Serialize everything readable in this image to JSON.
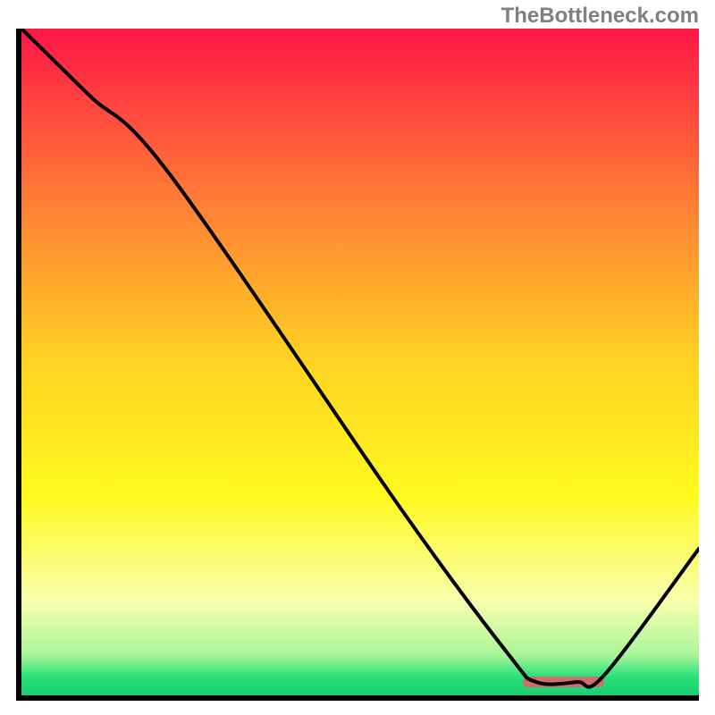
{
  "watermark": "TheBottleneck.com",
  "chart_data": {
    "type": "line",
    "title": "",
    "xlabel": "",
    "ylabel": "",
    "xlim": [
      0,
      100
    ],
    "ylim": [
      0,
      100
    ],
    "grid": false,
    "legend": false,
    "background": {
      "type": "vertical-gradient",
      "stops": [
        {
          "offset": 0.0,
          "color": "#ff1647"
        },
        {
          "offset": 0.25,
          "color": "#ff7a36"
        },
        {
          "offset": 0.5,
          "color": "#ffd323"
        },
        {
          "offset": 0.7,
          "color": "#fff91e"
        },
        {
          "offset": 0.86,
          "color": "#f8ffae"
        },
        {
          "offset": 0.94,
          "color": "#a9f59a"
        },
        {
          "offset": 0.97,
          "color": "#2fe37b"
        },
        {
          "offset": 1.0,
          "color": "#18cf71"
        }
      ]
    },
    "series": [
      {
        "name": "bottleneck-curve",
        "color": "#000000",
        "x": [
          0,
          10,
          22,
          56,
          72,
          76,
          82,
          86,
          100
        ],
        "y": [
          100,
          90,
          78,
          28,
          6,
          2,
          2,
          3,
          22
        ]
      }
    ],
    "marker": {
      "name": "optimal-range-marker",
      "color": "#d46a6a",
      "x_start": 74,
      "x_end": 86,
      "y": 2,
      "thickness_pct": 1.6
    }
  }
}
